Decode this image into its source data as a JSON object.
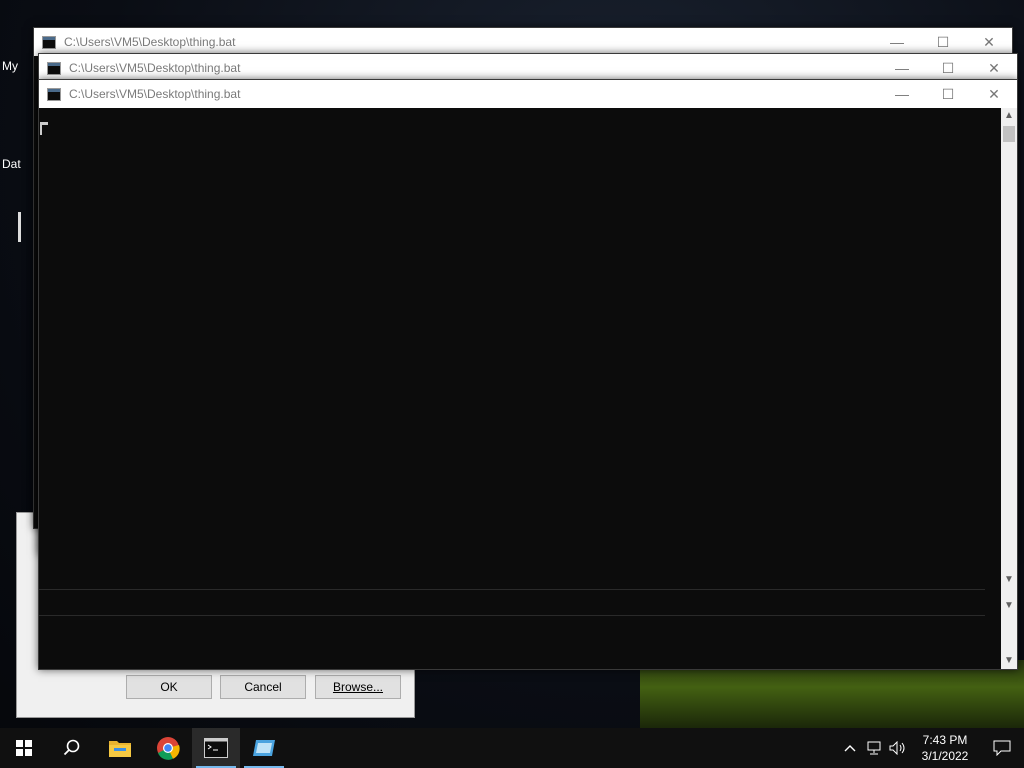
{
  "desktop": {
    "icons": [
      {
        "label": "My"
      },
      {
        "label": "Dat"
      }
    ]
  },
  "run_dialog": {
    "ok_label": "OK",
    "cancel_label": "Cancel",
    "browse_label": "Browse..."
  },
  "windows": [
    {
      "title": "C:\\Users\\VM5\\Desktop\\thing.bat"
    },
    {
      "title": "C:\\Users\\VM5\\Desktop\\thing.bat"
    },
    {
      "title": "C:\\Users\\VM5\\Desktop\\thing.bat"
    }
  ],
  "window_controls": {
    "minimize_glyph": "—",
    "maximize_glyph": "☐",
    "close_glyph": "✕"
  },
  "taskbar": {
    "apps": [
      {
        "name": "start-icon"
      },
      {
        "name": "search-icon"
      },
      {
        "name": "file-explorer-icon"
      },
      {
        "name": "chrome-icon"
      },
      {
        "name": "command-prompt-icon"
      },
      {
        "name": "run-dialog-icon"
      }
    ],
    "tray": {
      "time": "7:43 PM",
      "date": "3/1/2022"
    }
  },
  "colors": {
    "console_bg": "#0c0c0c",
    "taskbar_bg": "#101010",
    "accent": "#76b9ed"
  }
}
